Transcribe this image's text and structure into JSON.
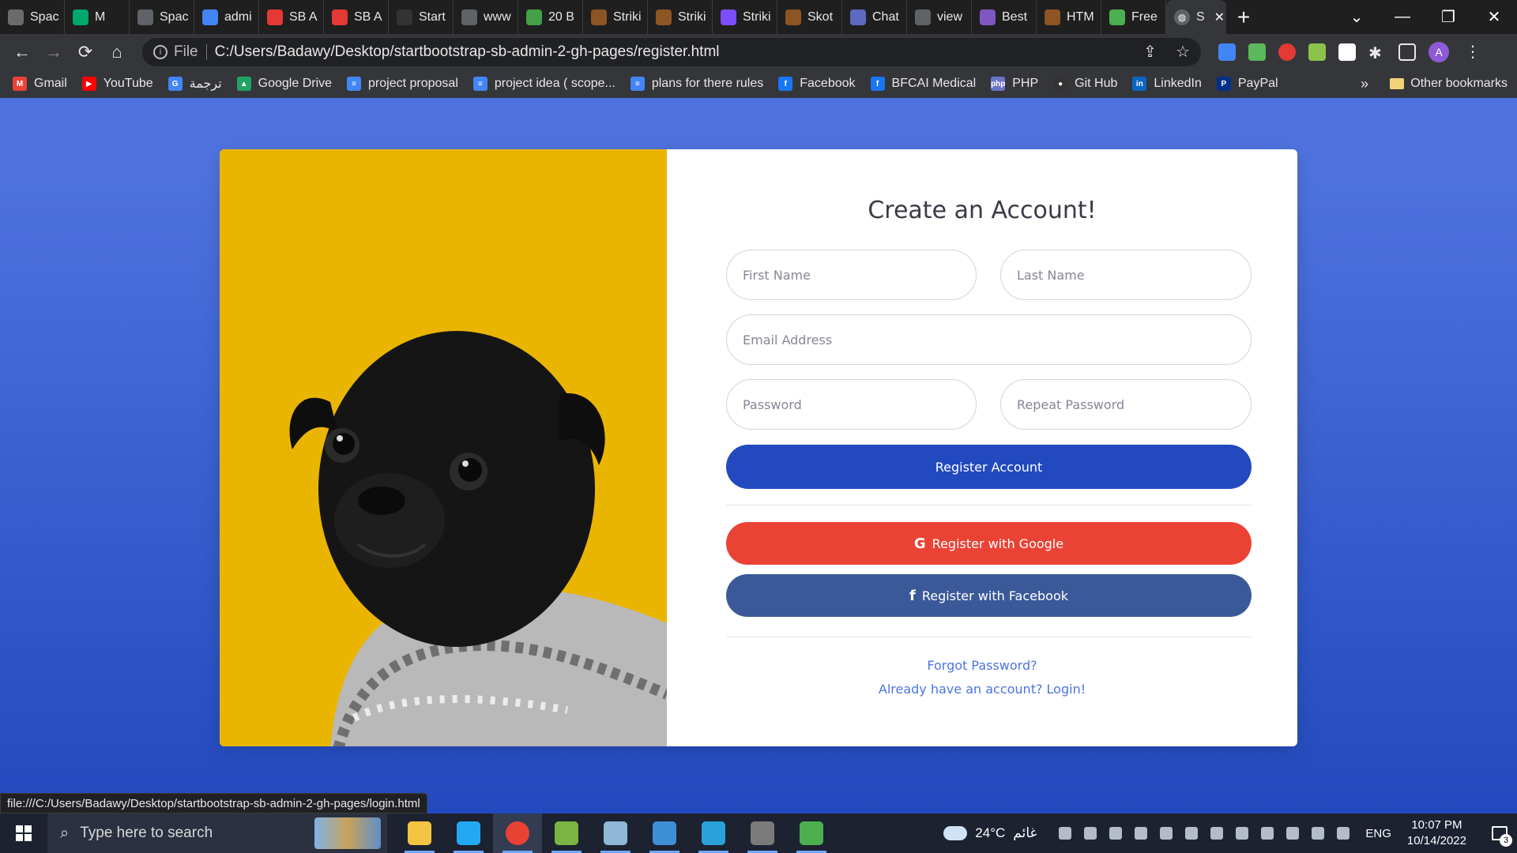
{
  "tabs": [
    {
      "label": "Spac",
      "icon": "space-icon",
      "color": "#6b6b6b"
    },
    {
      "label": "M",
      "icon": "meet-icon",
      "color": "#00a86b"
    },
    {
      "label": "Spac",
      "icon": "globe-icon",
      "color": "#5f6368"
    },
    {
      "label": "admi",
      "icon": "google-icon",
      "color": "#4285f4"
    },
    {
      "label": "SB A",
      "icon": "sb-admin-icon",
      "color": "#e53935"
    },
    {
      "label": "SB A",
      "icon": "sb-admin-icon",
      "color": "#e53935"
    },
    {
      "label": "Start",
      "icon": "github-icon",
      "color": "#333333"
    },
    {
      "label": "www",
      "icon": "globe-icon",
      "color": "#5f6368"
    },
    {
      "label": "20 B",
      "icon": "leaf-icon",
      "color": "#43a047"
    },
    {
      "label": "Striki",
      "icon": "striking-icon",
      "color": "#8d5524"
    },
    {
      "label": "Striki",
      "icon": "striking-icon",
      "color": "#8d5524"
    },
    {
      "label": "Striki",
      "icon": "heart-icon",
      "color": "#7c4dff"
    },
    {
      "label": "Skot",
      "icon": "striking-icon",
      "color": "#8d5524"
    },
    {
      "label": "Chat",
      "icon": "chat-icon",
      "color": "#5c6bc0"
    },
    {
      "label": "view",
      "icon": "globe-icon",
      "color": "#5f6368"
    },
    {
      "label": "Best",
      "icon": "colorlib-icon",
      "color": "#7e57c2"
    },
    {
      "label": "HTM",
      "icon": "striking-icon",
      "color": "#8d5524"
    },
    {
      "label": "Free",
      "icon": "free-icon",
      "color": "#4caf50"
    }
  ],
  "active_tab": {
    "label": "S",
    "close": "✕"
  },
  "new_tab": "+",
  "window_controls": {
    "minimize": "—",
    "restore": "❐",
    "close": "✕",
    "tab_search": "⌄"
  },
  "address_bar": {
    "scheme_label": "File",
    "url": "C:/Users/Badawy/Desktop/startbootstrap-sb-admin-2-gh-pages/register.html"
  },
  "bookmarks": [
    {
      "label": "Gmail",
      "icon": "gmail-icon",
      "color": "#ea4335",
      "glyph": "M"
    },
    {
      "label": "YouTube",
      "icon": "youtube-icon",
      "color": "#ff0000",
      "glyph": "▶"
    },
    {
      "label": "ترجمة",
      "icon": "translate-icon",
      "color": "#4285f4",
      "glyph": "G"
    },
    {
      "label": "Google Drive",
      "icon": "drive-icon",
      "color": "#1fa463",
      "glyph": "▲"
    },
    {
      "label": "project proposal",
      "icon": "docs-icon",
      "color": "#4285f4",
      "glyph": "≡"
    },
    {
      "label": "project idea ( scope...",
      "icon": "docs-icon",
      "color": "#4285f4",
      "glyph": "≡"
    },
    {
      "label": "plans for there rules",
      "icon": "docs-icon",
      "color": "#4285f4",
      "glyph": "≡"
    },
    {
      "label": "Facebook",
      "icon": "facebook-icon",
      "color": "#1877f2",
      "glyph": "f"
    },
    {
      "label": "BFCAI Medical",
      "icon": "facebook-icon",
      "color": "#1877f2",
      "glyph": "f"
    },
    {
      "label": "PHP",
      "icon": "php-icon",
      "color": "#6a74c9",
      "glyph": "php"
    },
    {
      "label": "Git Hub",
      "icon": "github-icon",
      "color": "#333333",
      "glyph": "●"
    },
    {
      "label": "LinkedIn",
      "icon": "linkedin-icon",
      "color": "#0a66c2",
      "glyph": "in"
    },
    {
      "label": "PayPal",
      "icon": "paypal-icon",
      "color": "#003087",
      "glyph": "P"
    }
  ],
  "bookmarks_overflow": "»",
  "other_bookmarks": "Other bookmarks",
  "page": {
    "heading": "Create an Account!",
    "first_name_placeholder": "First Name",
    "last_name_placeholder": "Last Name",
    "email_placeholder": "Email Address",
    "password_placeholder": "Password",
    "repeat_password_placeholder": "Repeat Password",
    "register_button": "Register Account",
    "google_button": "Register with Google",
    "facebook_button": "Register with Facebook",
    "forgot_link": "Forgot Password?",
    "login_link": "Already have an account? Login!",
    "colors": {
      "primary": "#224abe",
      "google": "#ea4335",
      "facebook": "#3b5998",
      "image_bg": "#eab500"
    }
  },
  "status_url": "file:///C:/Users/Badawy/Desktop/startbootstrap-sb-admin-2-gh-pages/login.html",
  "taskbar": {
    "search_placeholder": "Type here to search",
    "apps": [
      {
        "name": "file-explorer-icon",
        "color": "#f4c542"
      },
      {
        "name": "vscode-icon",
        "color": "#23a9f2"
      },
      {
        "name": "chrome-icon",
        "color": "#e94235"
      },
      {
        "name": "lambda-app-icon",
        "color": "#7cb342"
      },
      {
        "name": "notes-app-icon",
        "color": "#8fb8d6"
      },
      {
        "name": "photos-app-icon",
        "color": "#3f8fd6"
      },
      {
        "name": "telegram-icon",
        "color": "#2aa1da"
      },
      {
        "name": "cpu-app-icon",
        "color": "#7a7a7a"
      },
      {
        "name": "idm-icon",
        "color": "#4caf50"
      }
    ],
    "weather_temp": "24°C",
    "weather_text": "غائم",
    "language": "ENG",
    "time": "10:07 PM",
    "date": "10/14/2022",
    "notification_count": "3"
  }
}
